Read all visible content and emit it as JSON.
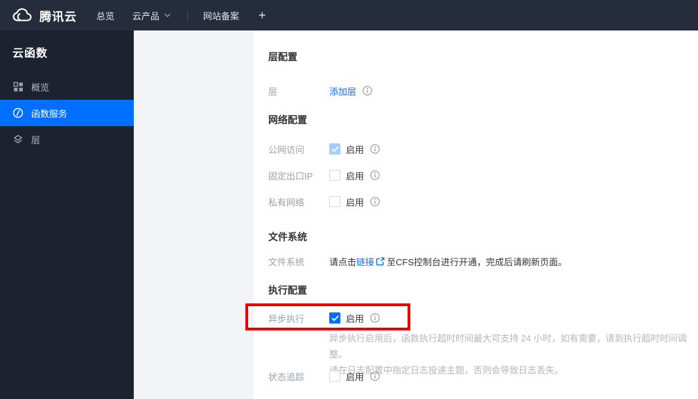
{
  "topbar": {
    "brand": "腾讯云",
    "nav": {
      "overview": "总览",
      "products": "云产品",
      "beian": "网站备案",
      "plus": "+"
    }
  },
  "sidebar": {
    "title": "云函数",
    "items": [
      {
        "label": "概览",
        "icon": "grid-icon",
        "active": false
      },
      {
        "label": "函数服务",
        "icon": "function-icon",
        "active": true
      },
      {
        "label": "层",
        "icon": "layers-icon",
        "active": false
      }
    ]
  },
  "form": {
    "layer_section": {
      "title": "层配置",
      "row_label": "层",
      "add_layer_link": "添加层"
    },
    "network_section": {
      "title": "网络配置",
      "rows": [
        {
          "label": "公网访问",
          "enable": "启用",
          "checked": true,
          "disabled": true
        },
        {
          "label": "固定出口IP",
          "enable": "启用",
          "checked": false,
          "disabled": false
        },
        {
          "label": "私有网络",
          "enable": "启用",
          "checked": false,
          "disabled": false
        }
      ]
    },
    "filesystem_section": {
      "title": "文件系统",
      "row_label": "文件系统",
      "text_before": "请点击",
      "link": "链接",
      "text_after": "至CFS控制台进行开通，完成后请刷新页面。"
    },
    "execution_section": {
      "title": "执行配置",
      "async_row": {
        "label": "异步执行",
        "enable": "启用",
        "checked": true
      },
      "helper_line1": "异步执行启用后，函数执行超时时间最大可支持 24 小时，如有需要，请到执行超时时间调整。",
      "helper_line2": "请在日志配置中指定日志投递主题，否则会导致日志丢失。",
      "trace_row": {
        "label": "状态追踪",
        "enable": "启用",
        "checked": false
      }
    }
  },
  "annotation": {
    "type": "highlight-box",
    "target": "异步执行"
  },
  "colors": {
    "accent_blue": "#006eff",
    "annotation_red": "#e60000",
    "topbar_bg": "#252d3c",
    "sidebar_bg": "#1d2230",
    "panel_bg": "#f2f4f7",
    "disabled_check_bg": "#a9cdfb"
  },
  "icons": {
    "brand": "cloud-icon",
    "overview": "grid-icon",
    "service": "function-icon",
    "layer": "layers-icon",
    "info": "info-icon",
    "external": "external-link-icon",
    "check": "check-icon",
    "caret": "chevron-down-icon",
    "plus": "plus-icon"
  }
}
